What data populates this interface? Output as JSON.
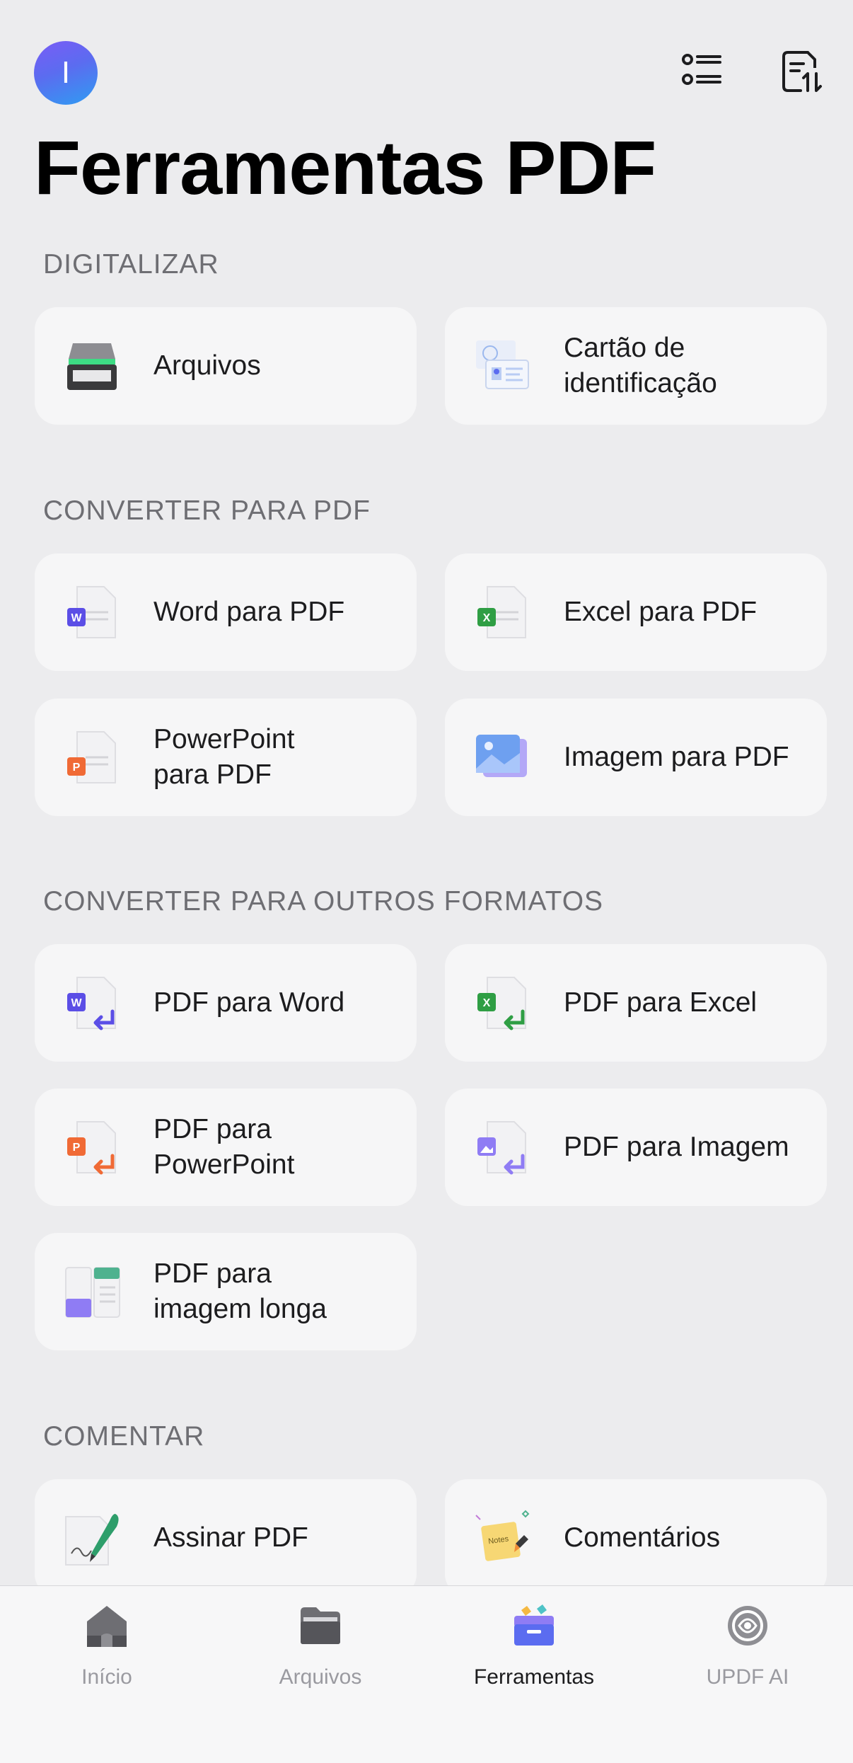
{
  "header": {
    "avatar_initial": "I",
    "title": "Ferramentas PDF"
  },
  "sections": {
    "digitalizar": {
      "title": "DIGITALIZAR",
      "items": [
        "Arquivos",
        "Cartão de\nidentificação"
      ]
    },
    "converter_para_pdf": {
      "title": "CONVERTER PARA PDF",
      "items": [
        "Word para PDF",
        "Excel para PDF",
        "PowerPoint\npara PDF",
        "Imagem para PDF"
      ]
    },
    "converter_outros": {
      "title": "CONVERTER PARA OUTROS FORMATOS",
      "items": [
        "PDF para Word",
        "PDF para Excel",
        "PDF para\nPowerPoint",
        "PDF para Imagem",
        "PDF para\nimagem longa"
      ]
    },
    "comentar": {
      "title": "COMENTAR",
      "items": [
        "Assinar PDF",
        "Comentários"
      ]
    }
  },
  "tabbar": {
    "tabs": [
      "Início",
      "Arquivos",
      "Ferramentas",
      "UPDF AI"
    ],
    "active": "Ferramentas"
  },
  "icons": {
    "top_right": [
      "list-view-icon",
      "sort-icon"
    ],
    "tabs": [
      "home-icon",
      "folder-icon",
      "tools-icon",
      "ai-icon"
    ]
  },
  "colors": {
    "word": "#5b4ee6",
    "excel": "#2f9e44",
    "powerpoint": "#f06a35",
    "image": "#8f7cf4",
    "accent_gradient_start": "#7a5cf6",
    "accent_gradient_end": "#2f9cf2"
  }
}
